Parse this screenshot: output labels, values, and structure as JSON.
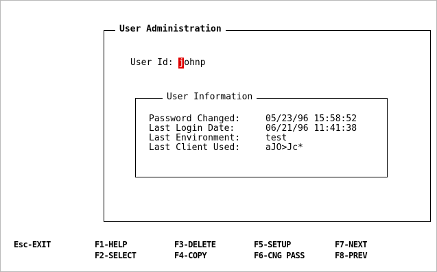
{
  "panel": {
    "title": "User Administration"
  },
  "user": {
    "label": "User Id:",
    "cursor_char": "j",
    "rest_value": "ohnp"
  },
  "info": {
    "title": "User Information",
    "rows": [
      {
        "label": "Password Changed:",
        "value": "05/23/96 15:58:52"
      },
      {
        "label": "Last Login Date:",
        "value": "06/21/96 11:41:38"
      },
      {
        "label": "Last Environment:",
        "value": "test"
      },
      {
        "label": "Last Client Used:",
        "value": "aJO>Jc*"
      }
    ]
  },
  "function_keys": {
    "esc_exit": "Esc-EXIT",
    "f1_help": "F1-HELP",
    "f2_select": "F2-SELECT",
    "f3_delete": "F3-DELETE",
    "f4_copy": "F4-COPY",
    "f5_setup": "F5-SETUP",
    "f6_cng_pass": "F6-CNG PASS",
    "f7_next": "F7-NEXT",
    "f8_prev": "F8-PREV"
  },
  "colors": {
    "cursor_bg": "#e00000",
    "background": "#ffffff",
    "text": "#000000"
  }
}
